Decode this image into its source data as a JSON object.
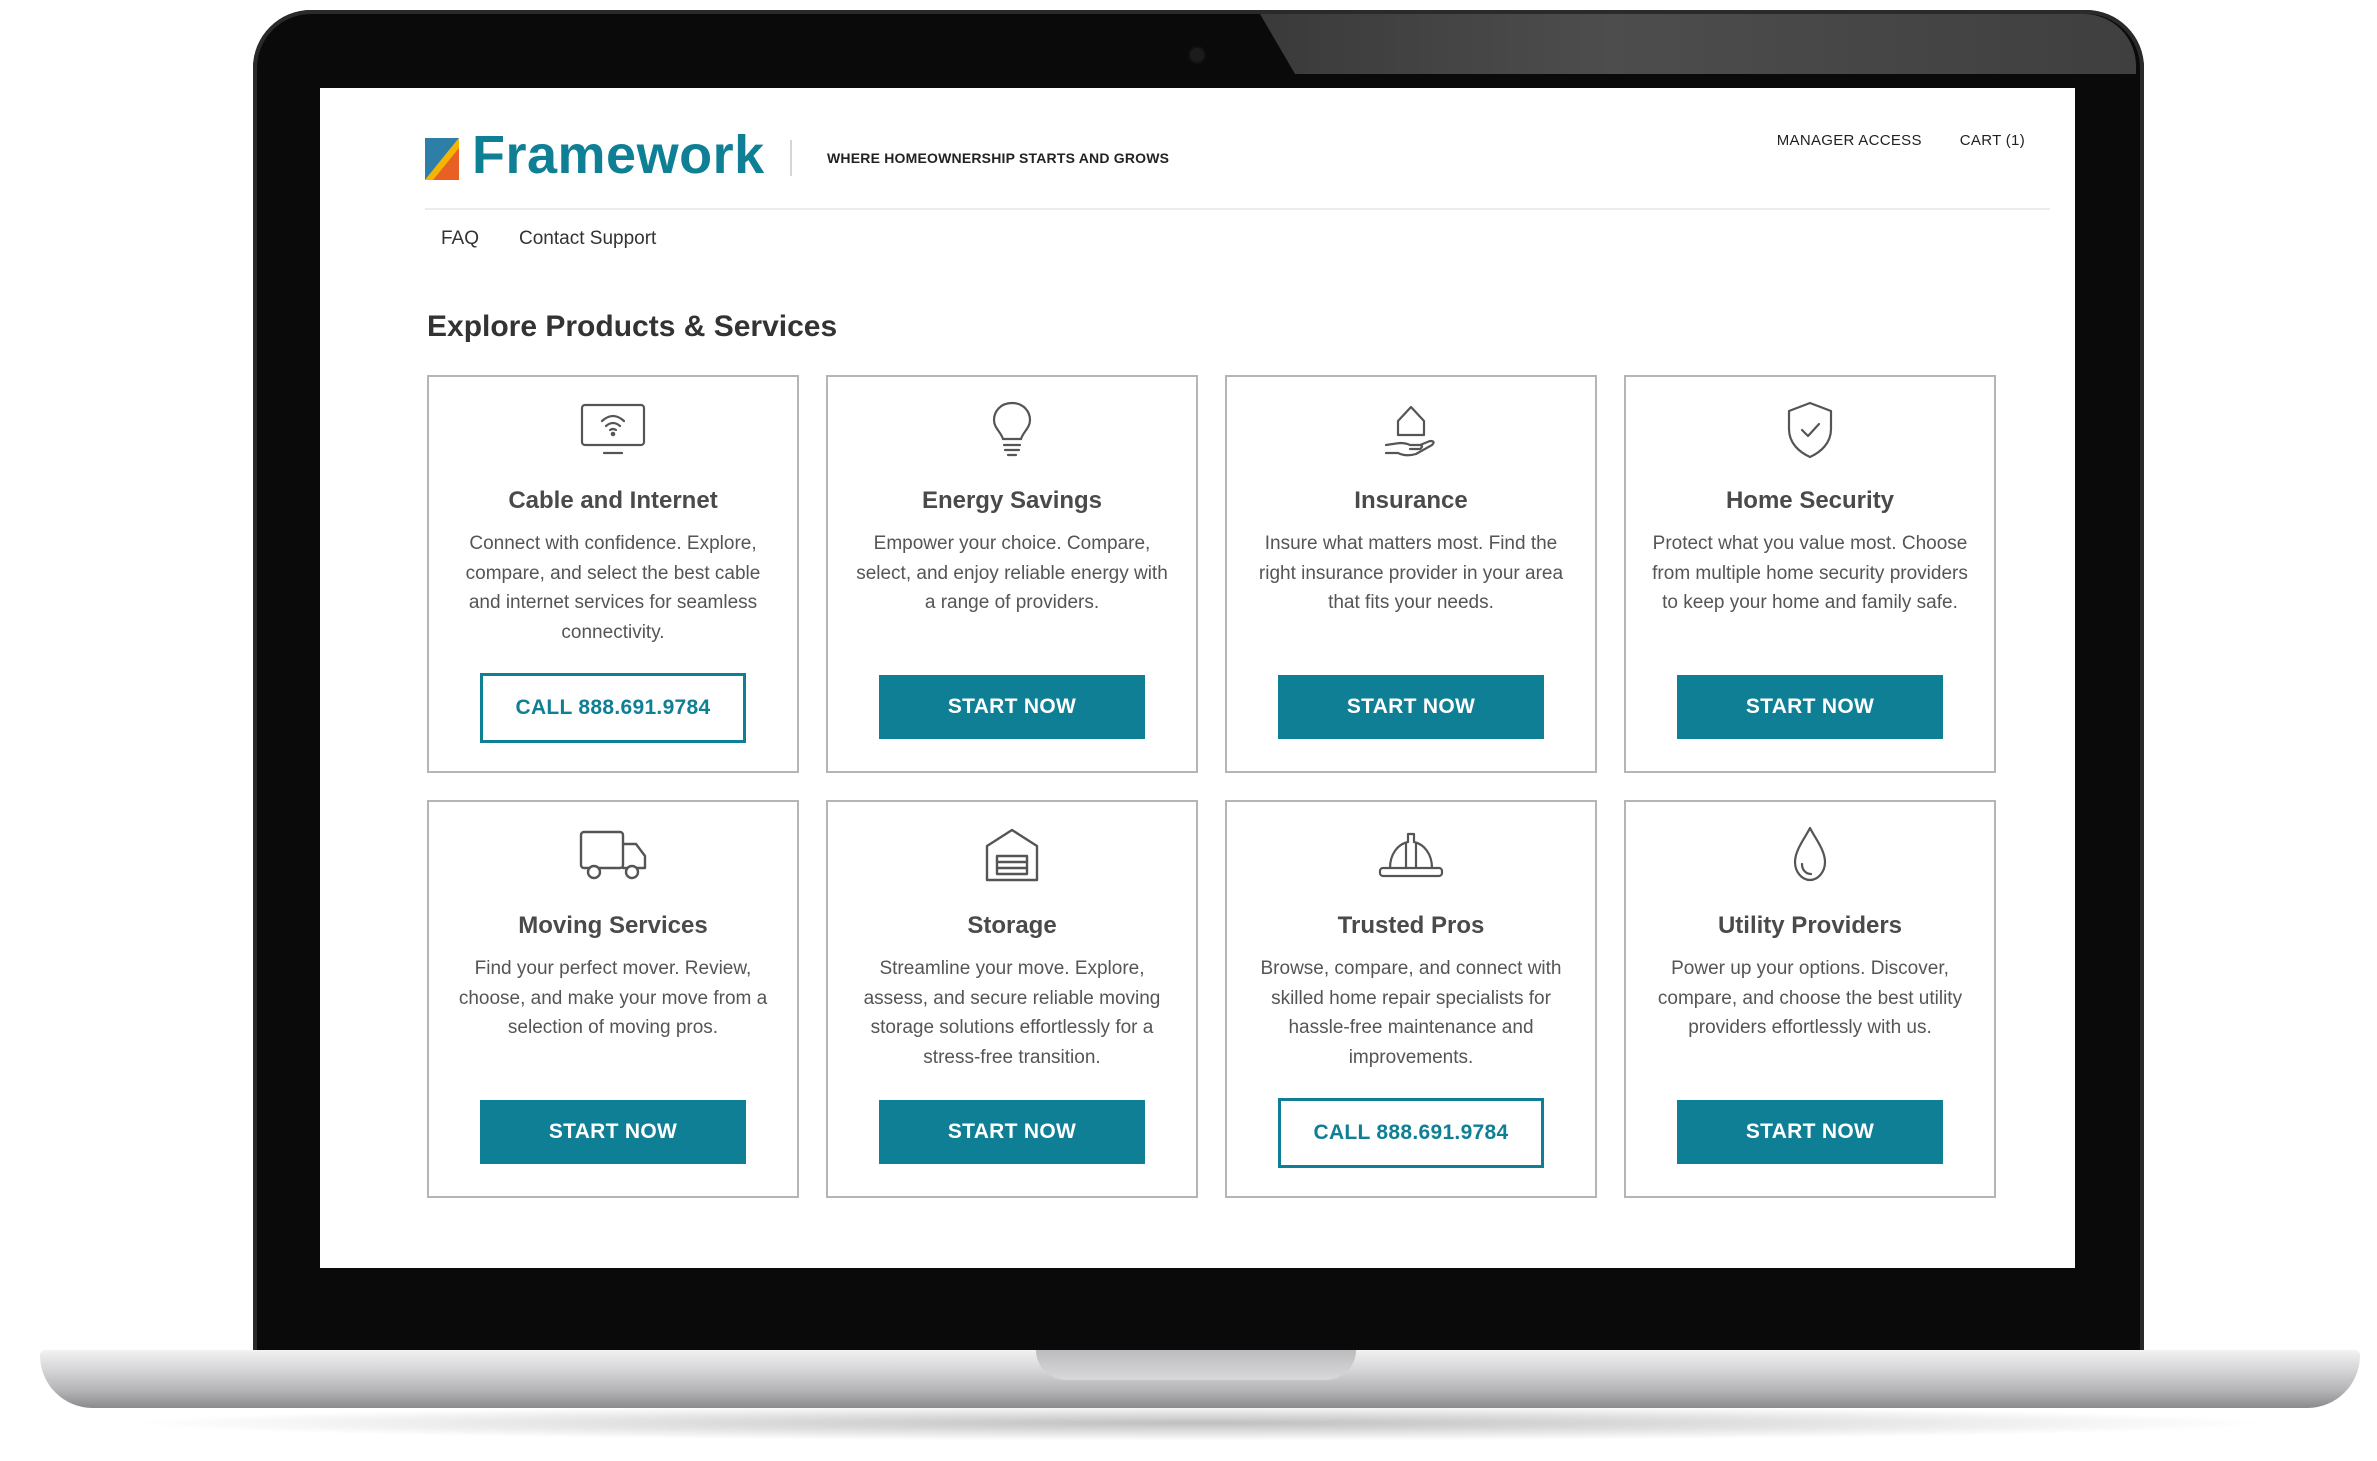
{
  "brand": {
    "name": "Framework",
    "tagline": "WHERE HOMEOWNERSHIP STARTS AND GROWS",
    "accent_color": "#0e7f95",
    "logo_colors": [
      "#f4b400",
      "#2e7fa8",
      "#e8562a"
    ]
  },
  "header": {
    "manager_access": "MANAGER ACCESS",
    "cart": "CART (1)"
  },
  "subnav": {
    "faq": "FAQ",
    "contact_support": "Contact Support"
  },
  "main": {
    "title": "Explore Products & Services",
    "cards": [
      {
        "icon": "tv-wifi-icon",
        "title": "Cable and Internet",
        "description": "Connect with confidence. Explore, compare, and select the best cable and internet services for seamless connectivity.",
        "button": "CALL 888.691.9784",
        "button_style": "outline"
      },
      {
        "icon": "lightbulb-icon",
        "title": "Energy Savings",
        "description": "Empower your choice. Compare, select, and enjoy reliable energy with a range of providers.",
        "button": "START NOW",
        "button_style": "solid"
      },
      {
        "icon": "house-in-hand-icon",
        "title": "Insurance",
        "description": "Insure what matters most. Find the right insurance provider in your area that fits your needs.",
        "button": "START NOW",
        "button_style": "solid"
      },
      {
        "icon": "shield-check-icon",
        "title": "Home Security",
        "description": "Protect what you value most. Choose from multiple home security providers to keep your home and family safe.",
        "button": "START NOW",
        "button_style": "solid"
      },
      {
        "icon": "truck-icon",
        "title": "Moving Services",
        "description": "Find your perfect mover. Review, choose, and make your move from a selection of moving pros.",
        "button": "START NOW",
        "button_style": "solid"
      },
      {
        "icon": "storage-icon",
        "title": "Storage",
        "description": "Streamline your move. Explore, assess, and secure reliable moving storage solutions effortlessly for a stress-free transition.",
        "button": "START NOW",
        "button_style": "solid"
      },
      {
        "icon": "hard-hat-icon",
        "title": "Trusted Pros",
        "description": "Browse, compare, and connect with skilled home repair specialists for hassle-free maintenance and improvements.",
        "button": "CALL 888.691.9784",
        "button_style": "outline"
      },
      {
        "icon": "water-drop-icon",
        "title": "Utility Providers",
        "description": "Power up your options. Discover, compare, and choose the best utility providers effortlessly with us.",
        "button": "START NOW",
        "button_style": "solid"
      }
    ]
  }
}
